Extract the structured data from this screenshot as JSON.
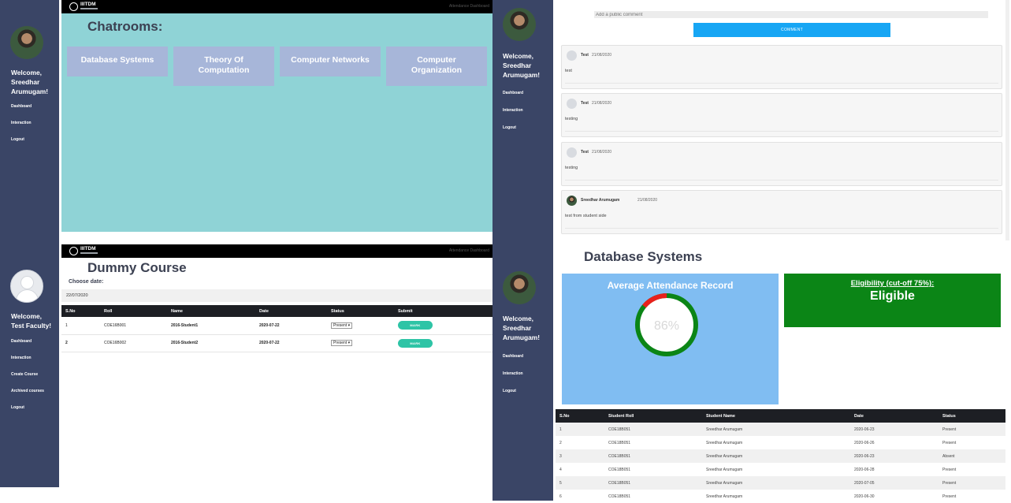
{
  "brand": {
    "logo_text": "IIITDM",
    "topbar_right": "Attendance Dashboard"
  },
  "student": {
    "welcome": "Welcome,\nSreedhar\nArumugam!"
  },
  "faculty": {
    "welcome": "Welcome,\nTest Faculty!"
  },
  "nav": {
    "dashboard": "Dashboard",
    "interaction": "Interaction",
    "logout": "Logout",
    "create_course": "Create Course",
    "archived_courses": "Archived courses"
  },
  "chatrooms": {
    "title": "Chatrooms:",
    "rooms": [
      "Database Systems",
      "Theory Of\nComputation",
      "Computer Networks",
      "Computer\nOrganization"
    ]
  },
  "comments": {
    "placeholder": "Add a public comment",
    "button": "COMMENT",
    "items": [
      {
        "name": "Test",
        "date": "21/08/2020",
        "text": "test"
      },
      {
        "name": "Test",
        "date": "21/08/2020",
        "text": "testing"
      },
      {
        "name": "Test",
        "date": "21/08/2020",
        "text": "testing"
      },
      {
        "name": "Sreedhar Arumugam",
        "date": "21/08/2020",
        "text": "test from student side"
      }
    ]
  },
  "course": {
    "title": "Dummy Course",
    "choose_date": "Choose date:",
    "date_value": "22/07/2020",
    "columns": [
      "S.No",
      "Roll",
      "Name",
      "Date",
      "Status",
      "Submit"
    ],
    "rows": [
      {
        "sno": "1",
        "roll": "COE16B001",
        "name": "2016-Student1",
        "date": "2020-07-22",
        "status": "Present",
        "submit": "MARK"
      },
      {
        "sno": "2",
        "roll": "COE16B002",
        "name": "2016-Student2",
        "date": "2020-07-22",
        "status": "Present",
        "submit": "MARK"
      }
    ]
  },
  "attendance": {
    "title": "Database Systems",
    "avg_title": "Average Attendance Record",
    "percent_label": "86%",
    "percent": 86,
    "eligibility_label": "Eligibility (cut-off 75%):",
    "eligibility_value": "Eligible",
    "colors": {
      "present": "#0b8516",
      "absent": "#e8201c"
    },
    "columns": [
      "S.No",
      "Student Roll",
      "Student Name",
      "Date",
      "Status"
    ],
    "rows": [
      {
        "sno": "1",
        "roll": "COE18B051",
        "name": "Sreedhar Arumugam",
        "date": "2020-06-23",
        "status": "Present"
      },
      {
        "sno": "2",
        "roll": "COE18B051",
        "name": "Sreedhar Arumugam",
        "date": "2020-06-26",
        "status": "Present"
      },
      {
        "sno": "3",
        "roll": "COE18B051",
        "name": "Sreedhar Arumugam",
        "date": "2020-06-23",
        "status": "Absent"
      },
      {
        "sno": "4",
        "roll": "COE18B051",
        "name": "Sreedhar Arumugam",
        "date": "2020-06-28",
        "status": "Present"
      },
      {
        "sno": "5",
        "roll": "COE18B051",
        "name": "Sreedhar Arumugam",
        "date": "2020-07-05",
        "status": "Present"
      },
      {
        "sno": "6",
        "roll": "COE18B051",
        "name": "Sreedhar Arumugam",
        "date": "2020-06-30",
        "status": "Present"
      }
    ]
  }
}
